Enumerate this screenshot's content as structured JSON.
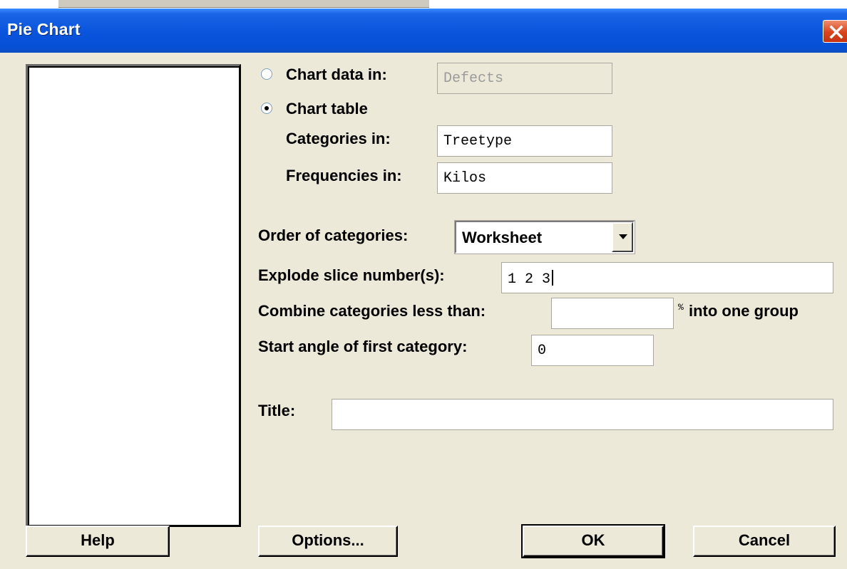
{
  "window": {
    "title": "Pie Chart"
  },
  "options": {
    "chart_data_in": {
      "label": "Chart data in:",
      "value": "Defects",
      "selected": false
    },
    "chart_table": {
      "label": "Chart table",
      "selected": true
    },
    "categories_in": {
      "label": "Categories in:",
      "value": "Treetype"
    },
    "frequencies_in": {
      "label": "Frequencies in:",
      "value": "Kilos"
    },
    "order_of_categories": {
      "label": "Order of categories:",
      "value": "Worksheet"
    },
    "explode_slices": {
      "label": "Explode slice number(s):",
      "value": "1 2 3"
    },
    "combine_categories": {
      "label": "Combine categories less than:",
      "value": "",
      "percent_sign": "%",
      "suffix": "into one group"
    },
    "start_angle": {
      "label": "Start angle of first category:",
      "value": "0"
    },
    "title": {
      "label": "Title:",
      "value": ""
    }
  },
  "buttons": {
    "help": "Help",
    "options": "Options...",
    "ok": "OK",
    "cancel": "Cancel"
  }
}
